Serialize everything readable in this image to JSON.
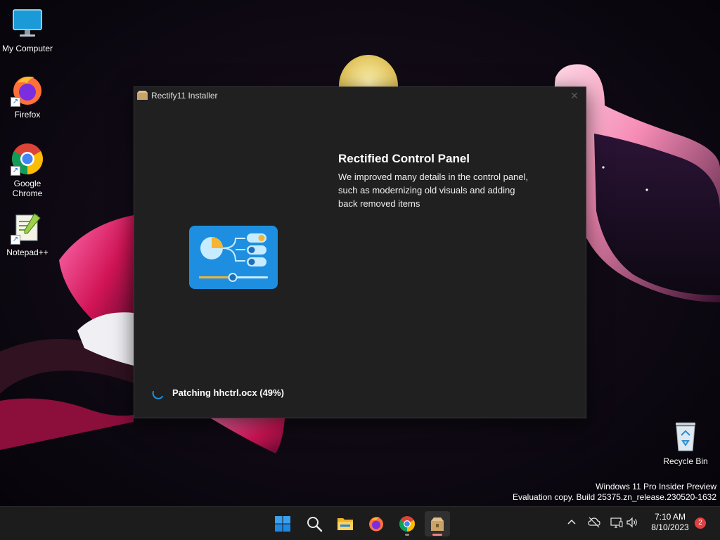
{
  "desktop": {
    "icons": [
      {
        "label": "My Computer",
        "icon": "monitor-icon"
      },
      {
        "label": "Firefox",
        "icon": "firefox-icon"
      },
      {
        "label": "Google Chrome",
        "icon": "chrome-icon"
      },
      {
        "label": "Notepad++",
        "icon": "notepadpp-icon"
      },
      {
        "label": "Recycle Bin",
        "icon": "recycle-bin-icon"
      }
    ],
    "watermark": {
      "line1": "Windows 11 Pro Insider Preview",
      "line2": "Evaluation copy. Build 25375.zn_release.230520-1632"
    }
  },
  "window": {
    "title": "Rectify11 Installer",
    "close_glyph": "✕",
    "feature": {
      "title": "Rectified Control Panel",
      "description": "We improved many details in the control panel, such as modernizing old visuals and adding back removed items",
      "icon": "control-panel-icon"
    },
    "status": "Patching hhctrl.ocx (49%)",
    "progress_percent": 49
  },
  "taskbar": {
    "items": [
      {
        "name": "start",
        "icon": "windows-start-icon"
      },
      {
        "name": "search",
        "icon": "search-icon"
      },
      {
        "name": "file-explorer",
        "icon": "folder-icon"
      },
      {
        "name": "firefox",
        "icon": "firefox-icon"
      },
      {
        "name": "chrome",
        "icon": "chrome-icon",
        "running": true
      },
      {
        "name": "rectify11-installer",
        "icon": "installer-icon",
        "active": true
      }
    ],
    "tray": {
      "overflow_icon": "chevron-up-icon",
      "network_icon": "cloud-offline-icon",
      "display_icon": "display-icon",
      "volume_icon": "volume-icon",
      "time": "7:10 AM",
      "date": "8/10/2023",
      "notification_count": "2"
    }
  },
  "colors": {
    "window_bg": "#202020",
    "accent_blue": "#1e8fe0",
    "taskbar_bg": "#1c1c1c"
  }
}
